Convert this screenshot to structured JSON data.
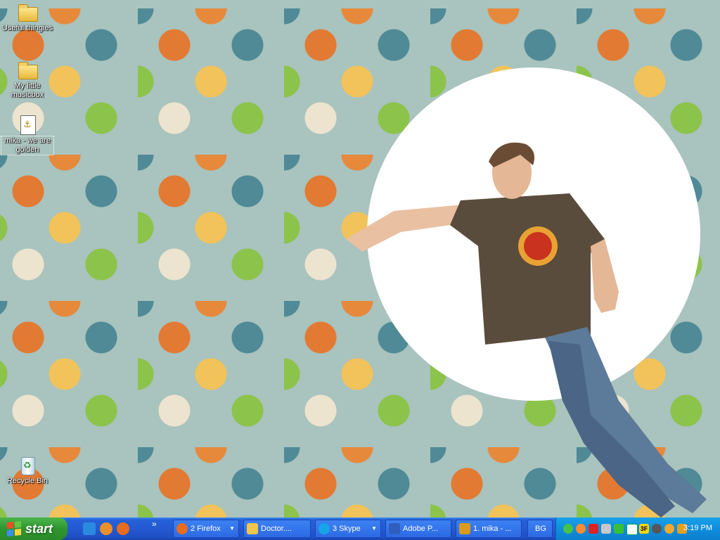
{
  "desktop": {
    "icons": [
      {
        "label": "Useful thingies",
        "icon": "folder-icon"
      },
      {
        "label": "My little musicbox",
        "icon": "folder-icon"
      },
      {
        "label": "mika - we are golden",
        "icon": "audio-file-icon"
      },
      {
        "label": "Recycle Bin",
        "icon": "recycle-bin-icon"
      }
    ]
  },
  "taskbar": {
    "start_label": "start",
    "overflow_chevron": "»",
    "buttons": [
      {
        "label": "2 Firefox",
        "icon": "firefox-icon",
        "color": "#e66c1f",
        "has_arrow": true
      },
      {
        "label": "Doctor....",
        "icon": "folder-icon",
        "color": "#f1c64a",
        "has_arrow": false
      },
      {
        "label": "3 Skype",
        "icon": "skype-icon",
        "color": "#18a4e8",
        "has_arrow": true
      },
      {
        "label": "Adobe P...",
        "icon": "adobe-icon",
        "color": "#2f5fbe",
        "has_arrow": false
      },
      {
        "label": "1. mika - ...",
        "icon": "media-player-icon",
        "color": "#d99a1e",
        "has_arrow": false
      },
      {
        "label": "BG",
        "icon": "",
        "color": "",
        "has_arrow": false
      }
    ],
    "quick_launch": [
      {
        "icon": "internet-explorer-icon",
        "color": "#2a8ae0"
      },
      {
        "icon": "winamp-icon",
        "color": "#e8902a"
      },
      {
        "icon": "firefox-icon",
        "color": "#e66c1f"
      }
    ],
    "tray": {
      "time": "3:19 PM",
      "icons": [
        {
          "icon": "network-icon",
          "color": "#49c24a"
        },
        {
          "icon": "messenger-icon",
          "color": "#ff8a30"
        },
        {
          "icon": "antivirus-icon",
          "color": "#d22"
        },
        {
          "icon": "volume-icon",
          "color": "#c8c8c8"
        },
        {
          "icon": "safely-remove-icon",
          "color": "#38c038"
        },
        {
          "icon": "skype-tray-icon",
          "color": "#ffffff"
        },
        {
          "icon": "badge-3f-icon",
          "color": "#ffd700"
        },
        {
          "icon": "steam-icon",
          "color": "#555"
        },
        {
          "icon": "updates-icon",
          "color": "#f0a830"
        },
        {
          "icon": "media-tray-icon",
          "color": "#e0a020"
        }
      ],
      "badge_text": "3F"
    }
  }
}
